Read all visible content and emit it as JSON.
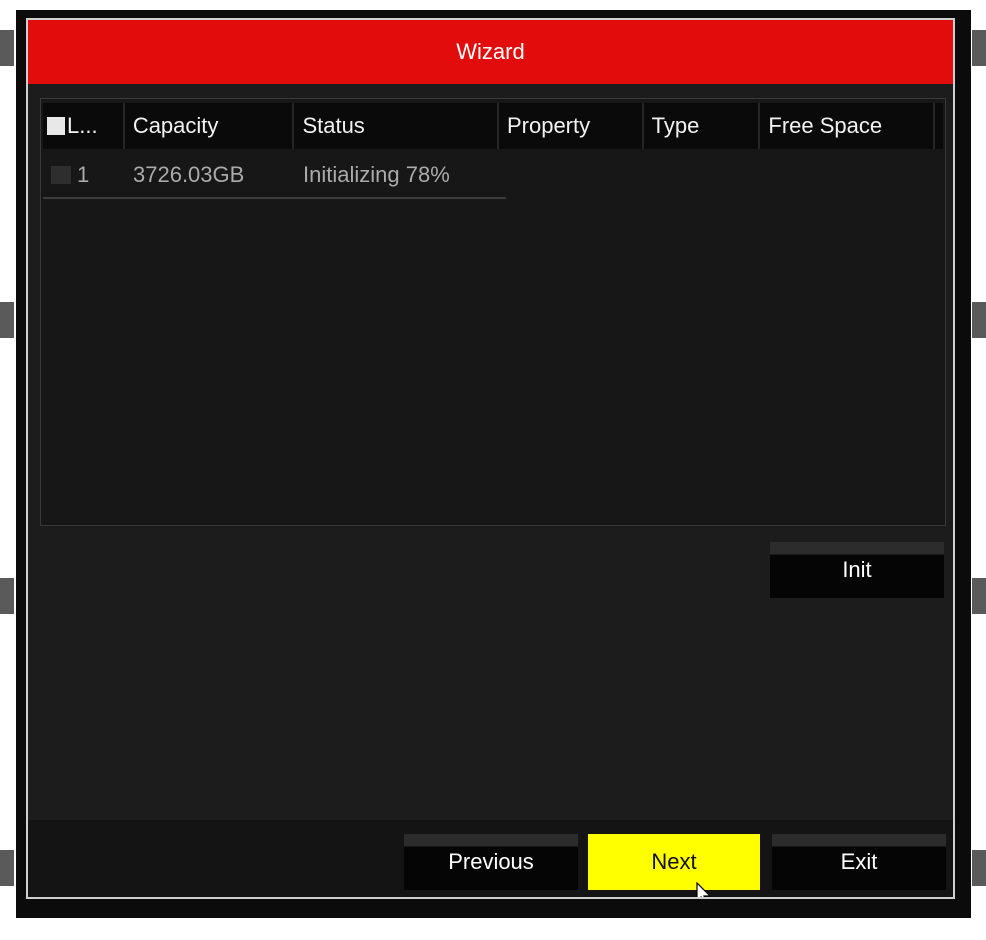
{
  "dialog": {
    "title": "Wizard"
  },
  "table": {
    "columns": [
      "L...",
      "Capacity",
      "Status",
      "Property",
      "Type",
      "Free Space",
      ""
    ],
    "rows": [
      {
        "label": "1",
        "capacity": "3726.03GB",
        "status": "Initializing 78%",
        "property": "",
        "type": "",
        "free_space": "",
        "selected": false
      }
    ]
  },
  "buttons": {
    "init": "Init",
    "previous": "Previous",
    "next": "Next",
    "exit": "Exit"
  },
  "colors": {
    "title_bar": "#e20c0c",
    "highlight_button": "#ffff00",
    "background": "#1c1c1c"
  },
  "icons": {
    "cursor": "mouse-pointer-icon"
  }
}
